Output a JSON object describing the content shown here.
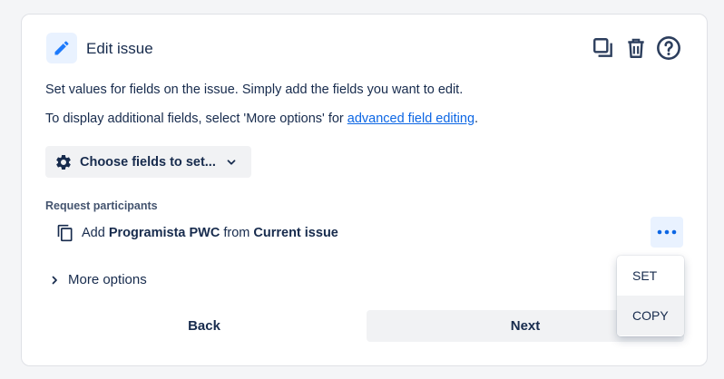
{
  "header": {
    "title": "Edit issue",
    "icons": [
      "pencil-icon",
      "copy-icon",
      "trash-icon",
      "help-icon"
    ]
  },
  "description": {
    "line1": "Set values for fields on the issue. Simply add the fields you want to edit.",
    "line2_prefix": "To display additional fields, select 'More options' for ",
    "line2_link": "advanced field editing",
    "line2_suffix": "."
  },
  "choose_fields": {
    "label": "Choose fields to set..."
  },
  "request_participants": {
    "label": "Request participants",
    "prefix": "Add",
    "value": "Programista PWC",
    "middle": "from",
    "source": "Current issue"
  },
  "more_options": {
    "label": "More options"
  },
  "footer": {
    "back_label": "Back",
    "next_label": "Next"
  },
  "dropdown": {
    "items": [
      "SET",
      "COPY"
    ],
    "highlighted": "COPY"
  },
  "colors": {
    "accent": "#0c66e4",
    "text": "#172b4d",
    "button_bg": "#f1f2f4",
    "icon_bg": "#e9f2ff"
  }
}
